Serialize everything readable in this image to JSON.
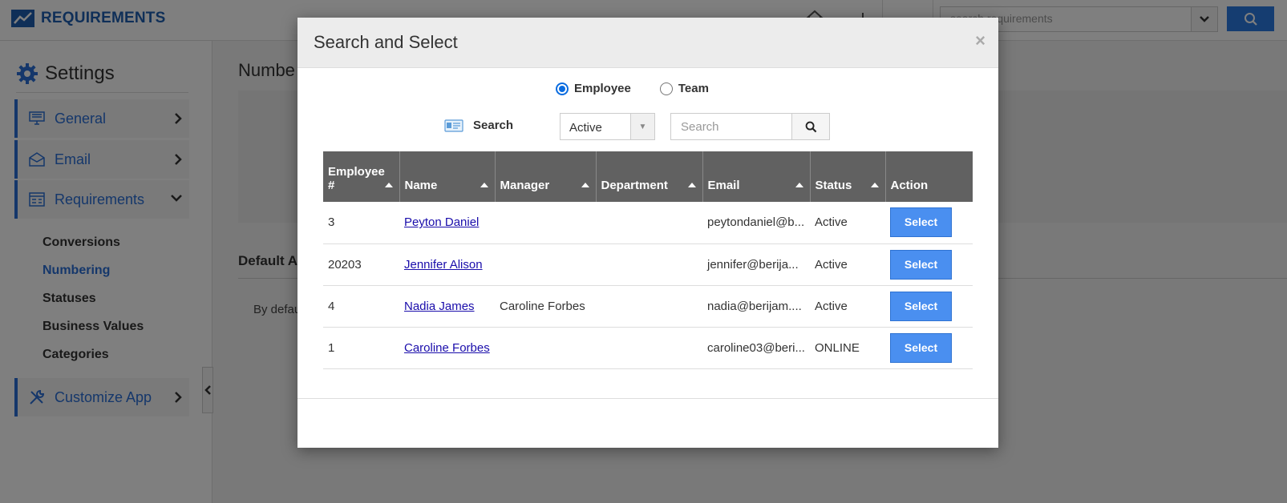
{
  "app": {
    "brand": "REQUIREMENTS",
    "global_search_placeholder": "search requirements"
  },
  "sidebar": {
    "title": "Settings",
    "items": [
      {
        "label": "General"
      },
      {
        "label": "Email"
      },
      {
        "label": "Requirements"
      },
      {
        "label": "Customize App"
      }
    ],
    "sub_items": [
      "Conversions",
      "Numbering",
      "Statuses",
      "Business Values",
      "Categories"
    ]
  },
  "main": {
    "title": "Numbe",
    "subtitle": "Default A",
    "text": "By defau"
  },
  "modal": {
    "title": "Search and Select",
    "close": "×",
    "radio_employee": "Employee",
    "radio_team": "Team",
    "search_label": "Search",
    "status_value": "Active",
    "search_placeholder": "Search",
    "columns": [
      "Employee #",
      "Name",
      "Manager",
      "Department",
      "Email",
      "Status",
      "Action"
    ],
    "rows": [
      {
        "id": "3",
        "name": "Peyton Daniel",
        "manager": "",
        "department": "",
        "email": "peytondaniel@b...",
        "status": "Active",
        "action": "Select"
      },
      {
        "id": "20203",
        "name": "Jennifer Alison",
        "manager": "",
        "department": "",
        "email": "jennifer@berija...",
        "status": "Active",
        "action": "Select"
      },
      {
        "id": "4",
        "name": "Nadia James",
        "manager": "Caroline Forbes",
        "department": "",
        "email": "nadia@berijam....",
        "status": "Active",
        "action": "Select"
      },
      {
        "id": "1",
        "name": "Caroline Forbes",
        "manager": "",
        "department": "",
        "email": "caroline03@beri...",
        "status": "ONLINE",
        "action": "Select"
      }
    ]
  },
  "colors": {
    "brand": "#1f5fb0",
    "accent": "#2a6fd6",
    "select_button": "#4a8ff0",
    "table_header": "#616161"
  }
}
